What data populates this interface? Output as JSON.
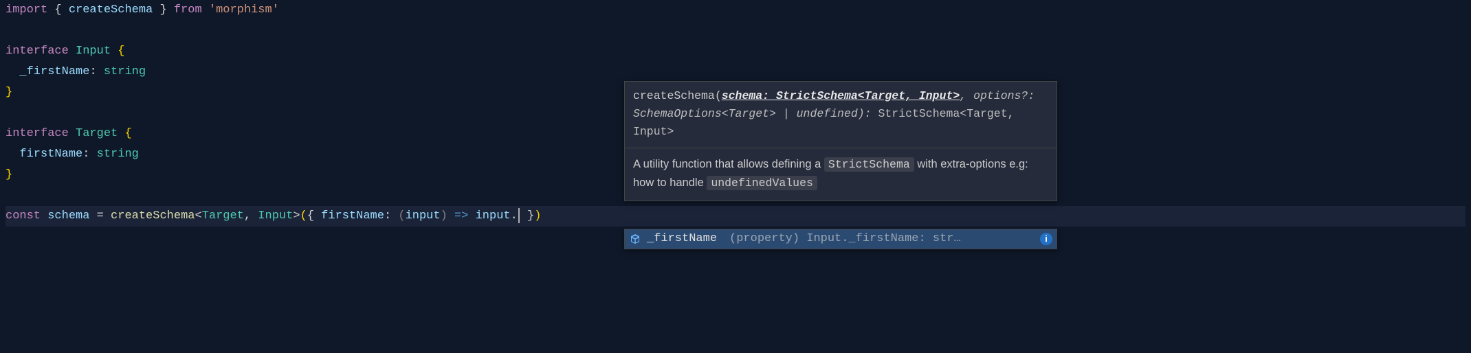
{
  "code": {
    "l1": {
      "import": "import",
      "lbrace": " { ",
      "ident": "createSchema",
      "rbrace": " } ",
      "from": "from",
      "sp": " ",
      "str": "'morphism'"
    },
    "l3": {
      "kw": "interface",
      "name": " Input ",
      "brace": "{"
    },
    "l4": {
      "indent": "  ",
      "prop": "_firstName",
      "colon": ":",
      "sp": " ",
      "type": "string"
    },
    "l5": {
      "brace": "}"
    },
    "l7": {
      "kw": "interface",
      "name": " Target ",
      "brace": "{"
    },
    "l8": {
      "indent": "  ",
      "prop": "firstName",
      "colon": ":",
      "sp": " ",
      "type": "string"
    },
    "l9": {
      "brace": "}"
    },
    "l11": {
      "const": "const",
      "ident": " schema ",
      "eq": "=",
      "sp": " ",
      "fn": "createSchema",
      "lt": "<",
      "t1": "Target",
      "comma1": ", ",
      "t2": "Input",
      "gt": ">",
      "lp": "(",
      "lb": "{ ",
      "prop": "firstName",
      "colon": ":",
      "sp2": " ",
      "lp2": "(",
      "param": "input",
      "rp2": ")",
      "arrow": " => ",
      "obj": "input",
      "dot": ".",
      "rb": " }",
      "rp": ")"
    }
  },
  "popup": {
    "sig_fn": "createSchema",
    "sig_open": "(",
    "sig_active": "schema: StrictSchema<Target, Input>",
    "sig_rest": ", options?: SchemaOptions<Target> | undefined",
    "sig_close": "):",
    "sig_ret": "StrictSchema<Target, Input>",
    "doc_pre": "A utility function that allows defining a ",
    "doc_code1": "StrictSchema",
    "doc_mid": " with extra-options e.g: how to handle ",
    "doc_code2": "undefinedValues"
  },
  "suggest": {
    "icon": "field-icon",
    "label": "_firstName",
    "detail": "(property) Input._firstName: str…",
    "info": "i"
  },
  "chart_data": null
}
